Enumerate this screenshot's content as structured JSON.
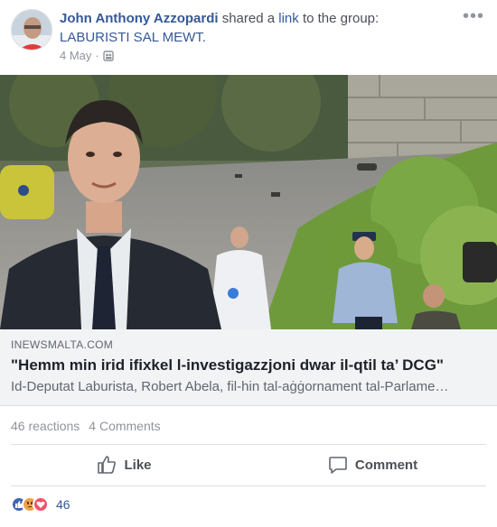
{
  "post": {
    "author": "John Anthony Azzopardi",
    "action_pre": "shared a",
    "action_link": "link",
    "action_post": "to the group:",
    "group": "LABURISTI SAL MEWT.",
    "date": "4 May",
    "date_sep": "·",
    "privacy_icon": "group-icon",
    "more": "•••"
  },
  "link_preview": {
    "domain": "INEWSMALTA.COM",
    "title": "\"Hemm min irid ifixkel l-investigazzjoni dwar il-qtil ta’ DCG\"",
    "description": "Id-Deputat Laburista, Robert Abela, fil-hin tal-aġġornament tal-Parlame…"
  },
  "stats": {
    "reactions": "46 reactions",
    "comments": "4 Comments"
  },
  "actions": {
    "like": "Like",
    "comment": "Comment"
  },
  "footer": {
    "reaction_icons": [
      "like-icon",
      "angry-icon",
      "love-icon"
    ],
    "count": "46"
  },
  "colors": {
    "link_blue": "#365899",
    "muted": "#90949c",
    "card_bg": "#f2f3f5",
    "like_blue": "#4267b2",
    "angry_orange": "#f0a24a",
    "love_red": "#f25268"
  }
}
